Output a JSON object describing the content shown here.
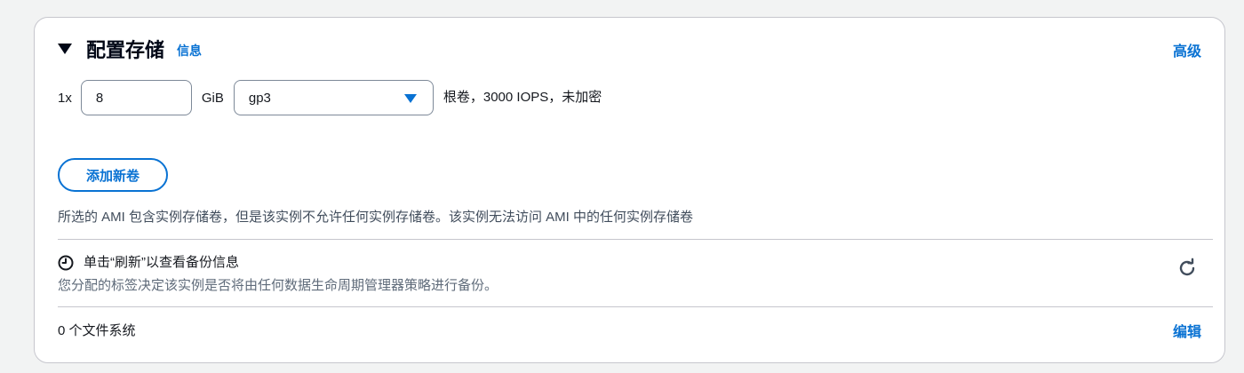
{
  "section": {
    "title": "配置存储",
    "info_link": "信息",
    "advanced_link": "高级"
  },
  "volume": {
    "multiplier": "1x",
    "size_value": "8",
    "unit": "GiB",
    "type_selected": "gp3",
    "description": "根卷，3000 IOPS，未加密"
  },
  "add_volume_button": "添加新卷",
  "ami_note": "所选的 AMI 包含实例存储卷，但是该实例不允许任何实例存储卷。该实例无法访问 AMI 中的任何实例存储卷",
  "backup": {
    "heading": "单击“刷新”以查看备份信息",
    "subtext": "您分配的标签决定该实例是否将由任何数据生命周期管理器策略进行备份。"
  },
  "file_systems": {
    "count_label": "0 个文件系统",
    "edit_link": "编辑"
  },
  "colors": {
    "accent": "#0972d3",
    "border": "#c6c6cd",
    "text": "#16191f",
    "muted": "#5f6b7a"
  },
  "icons": {
    "collapse": "caret-down-icon",
    "dropdown": "dropdown-arrow-icon",
    "backup": "clock-icon",
    "refresh": "refresh-icon"
  }
}
